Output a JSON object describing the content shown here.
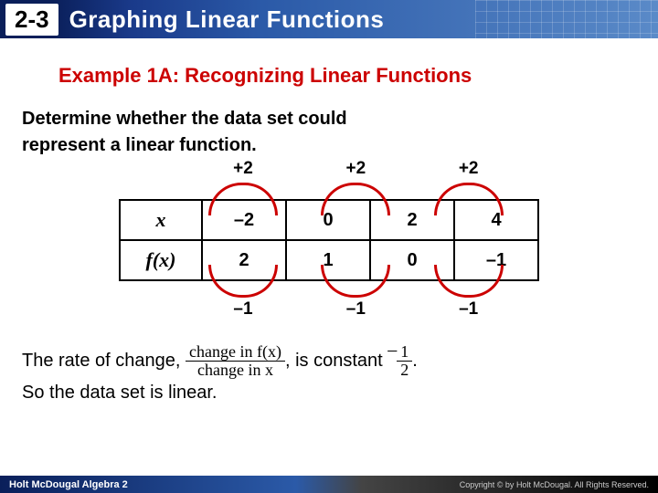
{
  "header": {
    "section": "2-3",
    "title": "Graphing Linear Functions"
  },
  "example_title": "Example 1A: Recognizing Linear Functions",
  "prompt_line1": "Determine whether the data set could",
  "prompt_line2": "represent a linear function.",
  "table": {
    "row_x_label": "x",
    "row_fx_label": "f(x)",
    "x_vals": [
      "–2",
      "0",
      "2",
      "4"
    ],
    "fx_vals": [
      "2",
      "1",
      "0",
      "–1"
    ],
    "top_deltas": [
      "+2",
      "+2",
      "+2"
    ],
    "bottom_deltas": [
      "–1",
      "–1",
      "–1"
    ]
  },
  "conclusion": {
    "part1": "The rate of change, ",
    "frac_num": "change in f(x)",
    "frac_den": "change in x",
    "part2": ", is constant ",
    "rate_num": "1",
    "rate_den": "2",
    "period": ".",
    "line2": "So the data set is linear."
  },
  "footer": {
    "left": "Holt McDougal Algebra 2",
    "right": "Copyright © by Holt McDougal. All Rights Reserved."
  }
}
